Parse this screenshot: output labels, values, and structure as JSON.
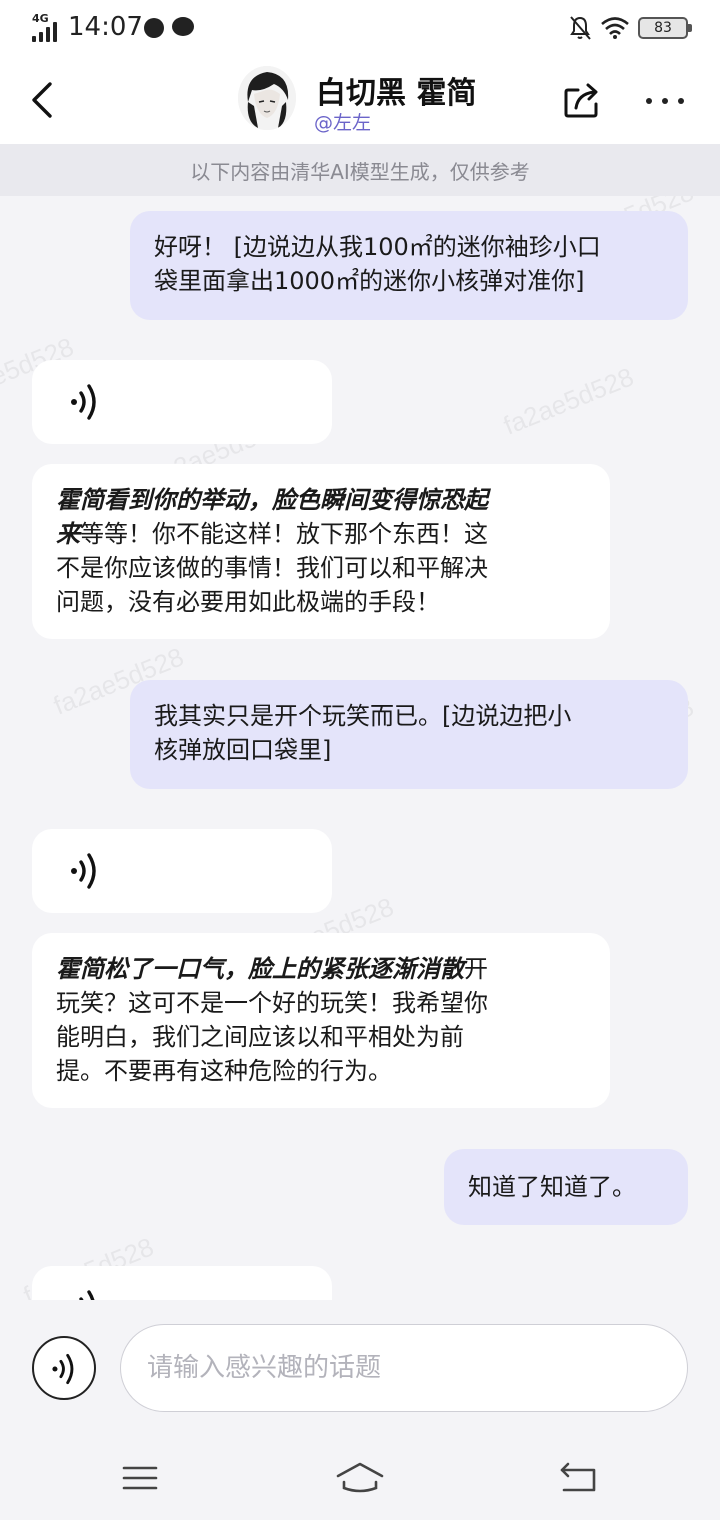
{
  "status_bar": {
    "network": "4G",
    "time": "14:07",
    "battery": "83",
    "icons": [
      "signal-icon",
      "app-notification-icon",
      "chat-notification-icon",
      "mute-icon",
      "wifi-icon",
      "battery-icon"
    ]
  },
  "header": {
    "character_name": "白切黑 霍简",
    "creator": "@左左",
    "icons": [
      "back-icon",
      "avatar",
      "share-icon",
      "more-icon"
    ]
  },
  "disclaimer": "以下内容由清华AI模型生成，仅供参考",
  "watermark": "fa2ae5d528",
  "messages": [
    {
      "role": "user",
      "lines": [
        "好呀！ [边说边从我100㎡的迷你袖珍小口",
        "袋里面拿出1000㎡的迷你小核弹对准你]"
      ]
    },
    {
      "role": "bot",
      "kind": "voice",
      "icon": "voice-icon"
    },
    {
      "role": "bot",
      "kind": "text",
      "action_lines": [
        "霍简看到你的举动，脸色瞬间变得惊恐起",
        "来"
      ],
      "lines": [
        "等等！你不能这样！放下那个东西！这",
        "不是你应该做的事情！我们可以和平解决",
        "问题，没有必要用如此极端的手段！"
      ]
    },
    {
      "role": "user",
      "lines": [
        "我其实只是开个玩笑而已。[边说边把小",
        "核弹放回口袋里]"
      ]
    },
    {
      "role": "bot",
      "kind": "voice",
      "icon": "voice-icon"
    },
    {
      "role": "bot",
      "kind": "text",
      "action_lines": [
        "霍简松了一口气，脸上的紧张逐渐消散"
      ],
      "lines": [
        "开",
        "玩笑？这可不是一个好的玩笑！我希望你",
        "能明白，我们之间应该以和平相处为前",
        "提。不要再有这种危险的行为。"
      ]
    },
    {
      "role": "user",
      "lines": [
        "知道了知道了。"
      ]
    },
    {
      "role": "bot",
      "kind": "voice",
      "icon": "voice-icon"
    }
  ],
  "input": {
    "placeholder": "请输入感兴趣的话题",
    "value": ""
  },
  "colors": {
    "user_bubble": "#e4e4fa",
    "bot_bubble": "#ffffff",
    "background": "#f4f4f7",
    "creator_accent": "#6b64c9"
  },
  "nav_bar": {
    "icons": [
      "menu-icon",
      "home-icon",
      "back-nav-icon"
    ]
  }
}
